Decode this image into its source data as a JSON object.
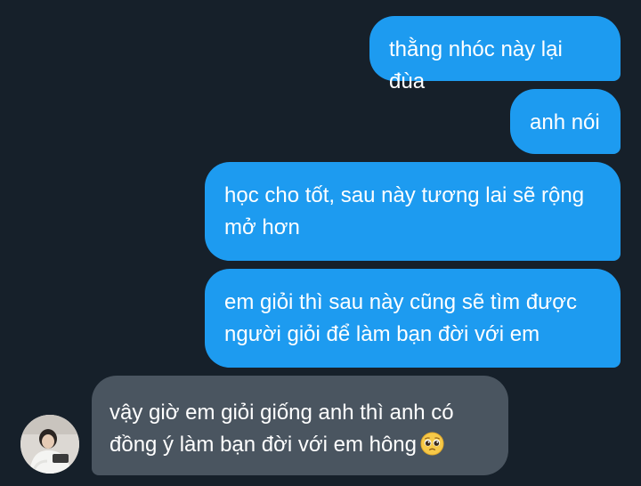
{
  "messages": [
    {
      "direction": "outgoing",
      "text": "thằng nhóc này lại đùa"
    },
    {
      "direction": "outgoing",
      "text": "anh nói"
    },
    {
      "direction": "outgoing",
      "text": "học cho tốt, sau này tương lai sẽ rộng mở hơn"
    },
    {
      "direction": "outgoing",
      "text": "em giỏi thì sau này cũng sẽ tìm được người giỏi để làm bạn đời với em"
    },
    {
      "direction": "incoming",
      "text": "vậy giờ em giỏi giống anh thì anh có đồng ý làm bạn đời với em hông",
      "emoji": "pleading-face"
    }
  ],
  "colors": {
    "background": "#16202a",
    "outgoing_bubble": "#1d9bf0",
    "incoming_bubble": "#4a5560",
    "text": "#ffffff"
  },
  "icons": {
    "avatar": "contact-avatar-photo",
    "emoji": "pleading-face-icon"
  }
}
